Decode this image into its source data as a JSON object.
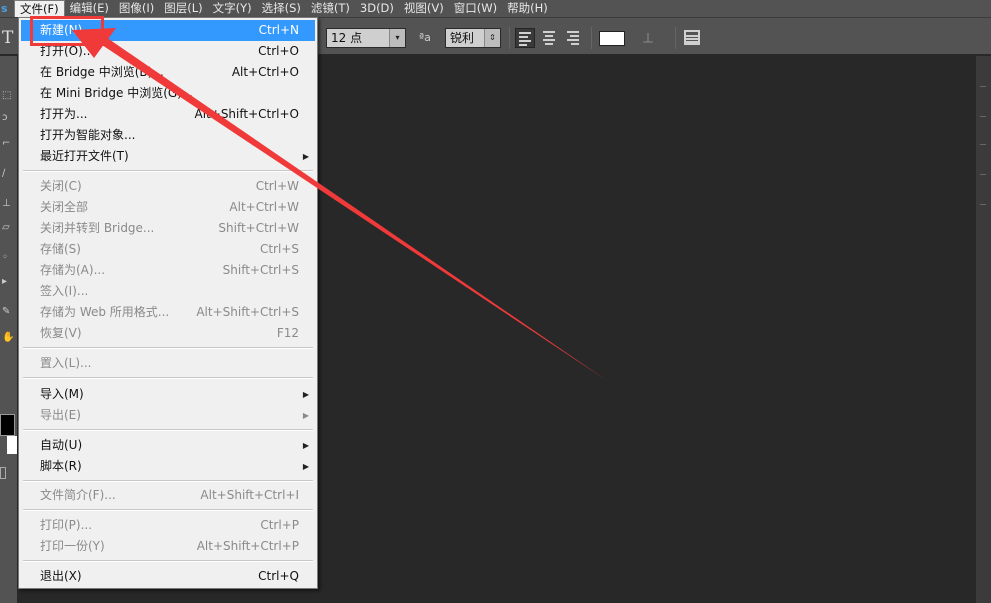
{
  "menubar": {
    "logo": "s",
    "items": [
      "文件(F)",
      "编辑(E)",
      "图像(I)",
      "图层(L)",
      "文字(Y)",
      "选择(S)",
      "滤镜(T)",
      "3D(D)",
      "视图(V)",
      "窗口(W)",
      "帮助(H)"
    ]
  },
  "options": {
    "tool_glyph": "T",
    "font_size": "12 点",
    "aa_icon": "ªa",
    "antialias": "锐利",
    "text_color": "#ffffff"
  },
  "file_menu": {
    "items": [
      {
        "label": "新建(N)...",
        "shortcut": "Ctrl+N",
        "state": "highlighted"
      },
      {
        "label": "打开(O)...",
        "shortcut": "Ctrl+O"
      },
      {
        "label": "在 Bridge 中浏览(B)...",
        "shortcut": "Alt+Ctrl+O"
      },
      {
        "label": "在 Mini Bridge 中浏览(G)...",
        "shortcut": ""
      },
      {
        "label": "打开为...",
        "shortcut": "Alt+Shift+Ctrl+O"
      },
      {
        "label": "打开为智能对象...",
        "shortcut": ""
      },
      {
        "label": "最近打开文件(T)",
        "shortcut": "",
        "submenu": true
      },
      {
        "label": "关闭(C)",
        "shortcut": "Ctrl+W",
        "state": "disabled"
      },
      {
        "label": "关闭全部",
        "shortcut": "Alt+Ctrl+W",
        "state": "disabled"
      },
      {
        "label": "关闭并转到 Bridge...",
        "shortcut": "Shift+Ctrl+W",
        "state": "disabled"
      },
      {
        "label": "存储(S)",
        "shortcut": "Ctrl+S",
        "state": "disabled"
      },
      {
        "label": "存储为(A)...",
        "shortcut": "Shift+Ctrl+S",
        "state": "disabled"
      },
      {
        "label": "签入(I)...",
        "shortcut": "",
        "state": "disabled"
      },
      {
        "label": "存储为 Web 所用格式...",
        "shortcut": "Alt+Shift+Ctrl+S",
        "state": "disabled"
      },
      {
        "label": "恢复(V)",
        "shortcut": "F12",
        "state": "disabled"
      },
      {
        "label": "置入(L)...",
        "shortcut": "",
        "state": "disabled"
      },
      {
        "label": "导入(M)",
        "shortcut": "",
        "submenu": true
      },
      {
        "label": "导出(E)",
        "shortcut": "",
        "submenu": true,
        "state": "disabled"
      },
      {
        "label": "自动(U)",
        "shortcut": "",
        "submenu": true
      },
      {
        "label": "脚本(R)",
        "shortcut": "",
        "submenu": true
      },
      {
        "label": "文件简介(F)...",
        "shortcut": "Alt+Shift+Ctrl+I",
        "state": "disabled"
      },
      {
        "label": "打印(P)...",
        "shortcut": "Ctrl+P",
        "state": "disabled"
      },
      {
        "label": "打印一份(Y)",
        "shortcut": "Alt+Shift+Ctrl+P",
        "state": "disabled"
      },
      {
        "label": "退出(X)",
        "shortcut": "Ctrl+Q"
      }
    ]
  },
  "colors": {
    "menu_highlight": "#3399ff",
    "annotation_red": "#f03a3a",
    "chrome": "#535353",
    "workspace": "#282828"
  },
  "icons": {
    "submenu": "submenu-arrow-icon",
    "align_left": "align-left-icon",
    "align_center": "align-center-icon",
    "align_right": "align-right-icon",
    "warp": "warp-text-icon",
    "panels": "character-panel-icon"
  }
}
